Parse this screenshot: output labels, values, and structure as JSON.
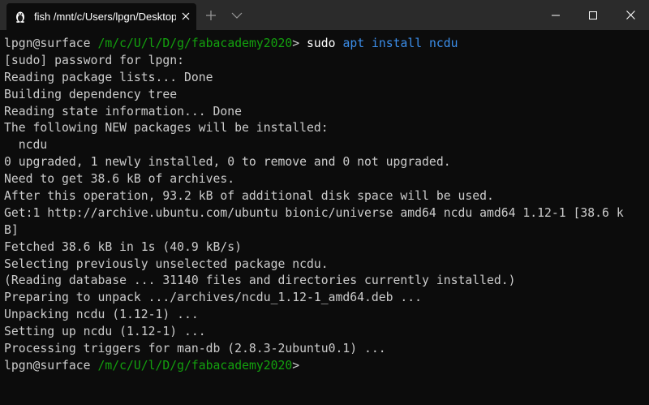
{
  "window": {
    "tab_title": "fish  /mnt/c/Users/lpgn/Desktop",
    "tab_icon": "linux-penguin-icon",
    "new_tab_icon": "plus-icon",
    "dropdown_icon": "chevron-down-icon",
    "minimize_icon": "minimize-icon",
    "maximize_icon": "maximize-icon",
    "close_icon": "close-icon"
  },
  "terminal": {
    "prompt_user": "lpgn@surface",
    "prompt_path": "/m/c/U/l/D/g/fabacademy2020",
    "prompt_symbol": ">",
    "command_name": "sudo",
    "command_args": "apt install ncdu",
    "output": [
      "[sudo] password for lpgn:",
      "Reading package lists... Done",
      "Building dependency tree",
      "Reading state information... Done",
      "The following NEW packages will be installed:",
      "  ncdu",
      "0 upgraded, 1 newly installed, 0 to remove and 0 not upgraded.",
      "Need to get 38.6 kB of archives.",
      "After this operation, 93.2 kB of additional disk space will be used.",
      "Get:1 http://archive.ubuntu.com/ubuntu bionic/universe amd64 ncdu amd64 1.12-1 [38.6 k",
      "B]",
      "Fetched 38.6 kB in 1s (40.9 kB/s)",
      "Selecting previously unselected package ncdu.",
      "(Reading database ... 31140 files and directories currently installed.)",
      "Preparing to unpack .../archives/ncdu_1.12-1_amd64.deb ...",
      "Unpacking ncdu (1.12-1) ...",
      "Setting up ncdu (1.12-1) ...",
      "Processing triggers for man-db (2.8.3-2ubuntu0.1) ..."
    ],
    "final_prompt_user": "lpgn@surface",
    "final_prompt_path": "/m/c/U/l/D/g/fabacademy2020",
    "final_prompt_symbol": ">"
  },
  "colors": {
    "background": "#0c0c0c",
    "titlebar": "#2b2b2b",
    "text": "#cccccc",
    "path_green": "#13a10e",
    "arg_blue": "#3b8eea"
  }
}
